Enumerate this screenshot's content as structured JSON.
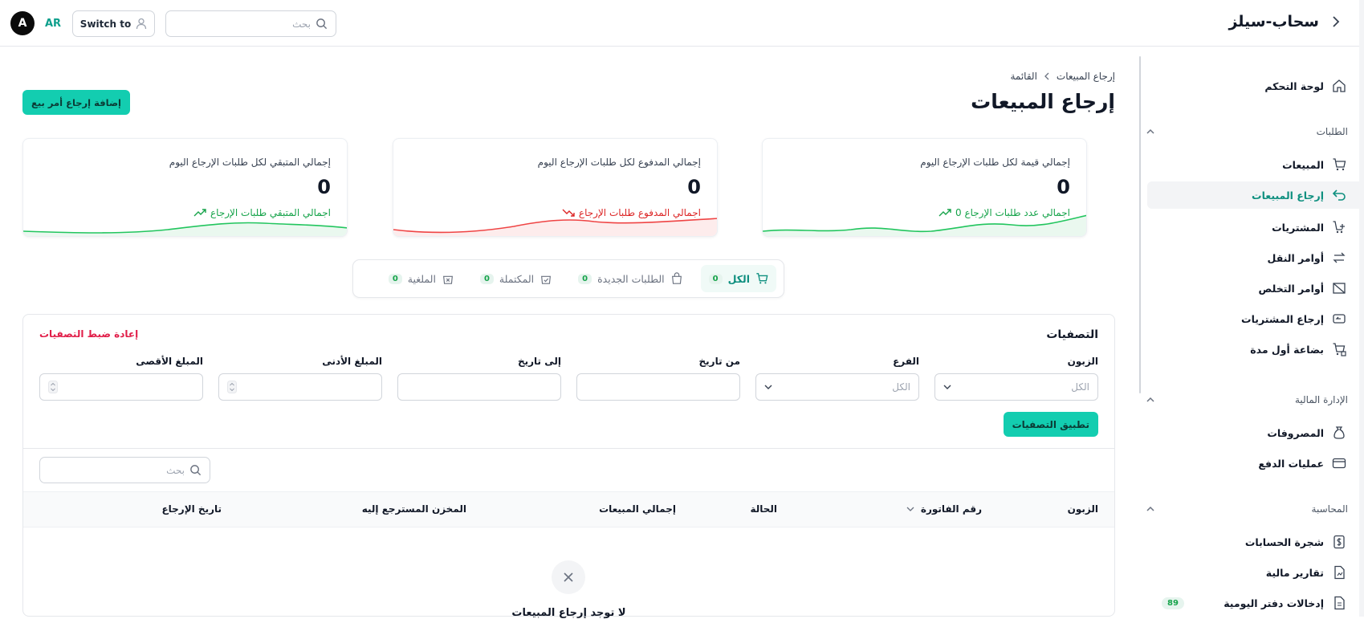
{
  "topbar": {
    "brand": "سحاب-سيلز",
    "search_placeholder": "بحث",
    "switch_label": "Switch to",
    "lang": "AR",
    "avatar_initial": "A"
  },
  "sidebar": {
    "dashboard": "لوحة التحكم",
    "sections": {
      "orders": "الطلبات",
      "finance": "الإدارة المالية",
      "accounting": "المحاسبة"
    },
    "orders_items": [
      "المبيعات",
      "إرجاع المبيعات",
      "المشتريات",
      "أوامر النقل",
      "أوامر التخلص",
      "إرجاع المشتريات",
      "بضاعة أول مدة"
    ],
    "finance_items": [
      "المصروفات",
      "عمليات الدفع"
    ],
    "accounting_items": [
      "شجرة الحسابات",
      "تقارير مالية",
      "إدخالات دفتر اليومية"
    ],
    "journal_badge": "89"
  },
  "page": {
    "breadcrumb": [
      "إرجاع المبيعات",
      "القائمة"
    ],
    "title": "إرجاع المبيعات",
    "add_button": "إضافة إرجاع أمر بيع"
  },
  "cards": [
    {
      "title": "إجمالي قيمة لكل طلبات الإرجاع اليوم",
      "value": "0",
      "trend": "اجمالي عدد طلبات الإرجاع 0",
      "trend_color": "#16a34a"
    },
    {
      "title": "إجمالي المدفوع لكل طلبات الإرجاع اليوم",
      "value": "0",
      "trend": "اجمالي المدفوع طلبات الإرجاع",
      "trend_color": "#dc2626"
    },
    {
      "title": "إجمالي المتبقي لكل طلبات الإرجاع اليوم",
      "value": "0",
      "trend": "اجمالي المتبقي طلبات الإرجاع",
      "trend_color": "#16a34a"
    }
  ],
  "tabs": [
    {
      "label": "الكل",
      "count": "0"
    },
    {
      "label": "الطلبات الجديدة",
      "count": "0"
    },
    {
      "label": "المكتملة",
      "count": "0"
    },
    {
      "label": "الملغية",
      "count": "0"
    }
  ],
  "filters": {
    "title": "التصفيات",
    "reset": "إعادة ضبط التصفيات",
    "labels": {
      "customer": "الزبون",
      "branch": "الفرع",
      "from_date": "من تاريخ",
      "to_date": "إلى تاريخ",
      "min_amount": "المبلغ الأدنى",
      "max_amount": "المبلغ الأقصى"
    },
    "customer_value": "الكل",
    "branch_value": "الكل",
    "apply": "تطبيق التصفيات"
  },
  "table": {
    "search_placeholder": "بحث",
    "columns": [
      "الزبون",
      "رقم الفاتورة",
      "الحالة",
      "إجمالي المبيعات",
      "المخزن المسترجع إليه",
      "تاريخ الإرجاع"
    ],
    "empty": "لا توجد إرجاع المبيعات"
  },
  "colors": {
    "accent": "#13cdb0",
    "green": "#16a34a",
    "red": "#dc2626"
  }
}
